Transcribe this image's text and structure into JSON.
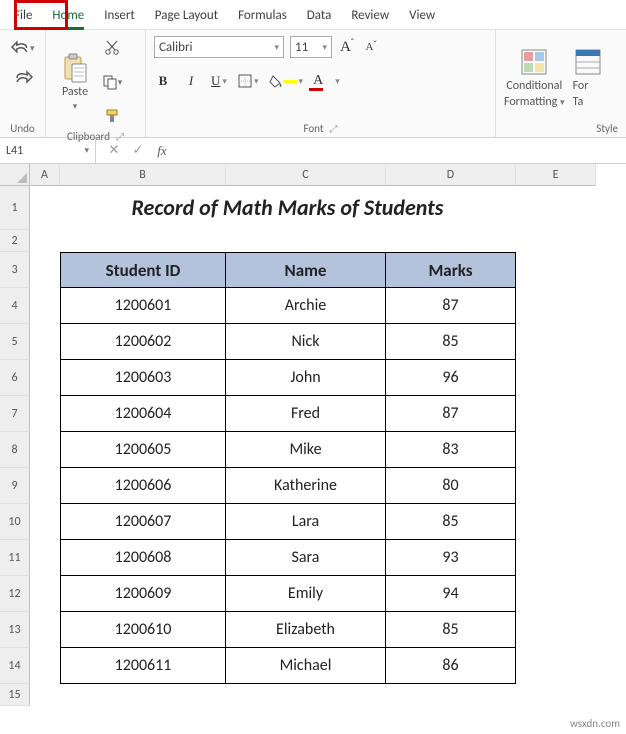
{
  "tabs": {
    "file": "File",
    "home": "Home",
    "insert": "Insert",
    "page_layout": "Page Layout",
    "formulas": "Formulas",
    "data": "Data",
    "review": "Review",
    "view": "View"
  },
  "ribbon": {
    "undo_group": "Undo",
    "clipboard_group": "Clipboard",
    "font_group": "Font",
    "styles_group": "Style",
    "paste_label": "Paste",
    "cond_format_label1": "Conditional",
    "cond_format_label2": "Formatting",
    "format_as_label1": "For",
    "format_as_label2": "Ta",
    "font_name": "Calibri",
    "font_size": "11",
    "bold": "B",
    "italic": "I",
    "underline": "U",
    "big_a": "A",
    "small_a": "A",
    "letter_a": "A"
  },
  "namebox": {
    "value": "L41"
  },
  "formula_bar": {
    "cancel": "✕",
    "enter": "✓",
    "fx": "fx",
    "value": ""
  },
  "grid": {
    "col_headers": [
      "A",
      "B",
      "C",
      "D",
      "E"
    ],
    "row_headers": [
      "1",
      "2",
      "3",
      "4",
      "5",
      "6",
      "7",
      "8",
      "9",
      "10",
      "11",
      "12",
      "13",
      "14",
      "15"
    ],
    "title": "Record of Math Marks of Students",
    "table_headers": {
      "id": "Student ID",
      "name": "Name",
      "marks": "Marks"
    },
    "rows": [
      {
        "id": "1200601",
        "name": "Archie",
        "marks": "87"
      },
      {
        "id": "1200602",
        "name": "Nick",
        "marks": "85"
      },
      {
        "id": "1200603",
        "name": "John",
        "marks": "96"
      },
      {
        "id": "1200604",
        "name": "Fred",
        "marks": "87"
      },
      {
        "id": "1200605",
        "name": "Mike",
        "marks": "83"
      },
      {
        "id": "1200606",
        "name": "Katherine",
        "marks": "80"
      },
      {
        "id": "1200607",
        "name": "Lara",
        "marks": "85"
      },
      {
        "id": "1200608",
        "name": "Sara",
        "marks": "93"
      },
      {
        "id": "1200609",
        "name": "Emily",
        "marks": "94"
      },
      {
        "id": "1200610",
        "name": "Elizabeth",
        "marks": "85"
      },
      {
        "id": "1200611",
        "name": "Michael",
        "marks": "86"
      }
    ]
  },
  "watermark": "wsxdn.com",
  "chart_data": {
    "type": "table",
    "title": "Record of Math Marks of Students",
    "columns": [
      "Student ID",
      "Name",
      "Marks"
    ],
    "rows": [
      [
        "1200601",
        "Archie",
        87
      ],
      [
        "1200602",
        "Nick",
        85
      ],
      [
        "1200603",
        "John",
        96
      ],
      [
        "1200604",
        "Fred",
        87
      ],
      [
        "1200605",
        "Mike",
        83
      ],
      [
        "1200606",
        "Katherine",
        80
      ],
      [
        "1200607",
        "Lara",
        85
      ],
      [
        "1200608",
        "Sara",
        93
      ],
      [
        "1200609",
        "Emily",
        94
      ],
      [
        "1200610",
        "Elizabeth",
        85
      ],
      [
        "1200611",
        "Michael",
        86
      ]
    ]
  }
}
